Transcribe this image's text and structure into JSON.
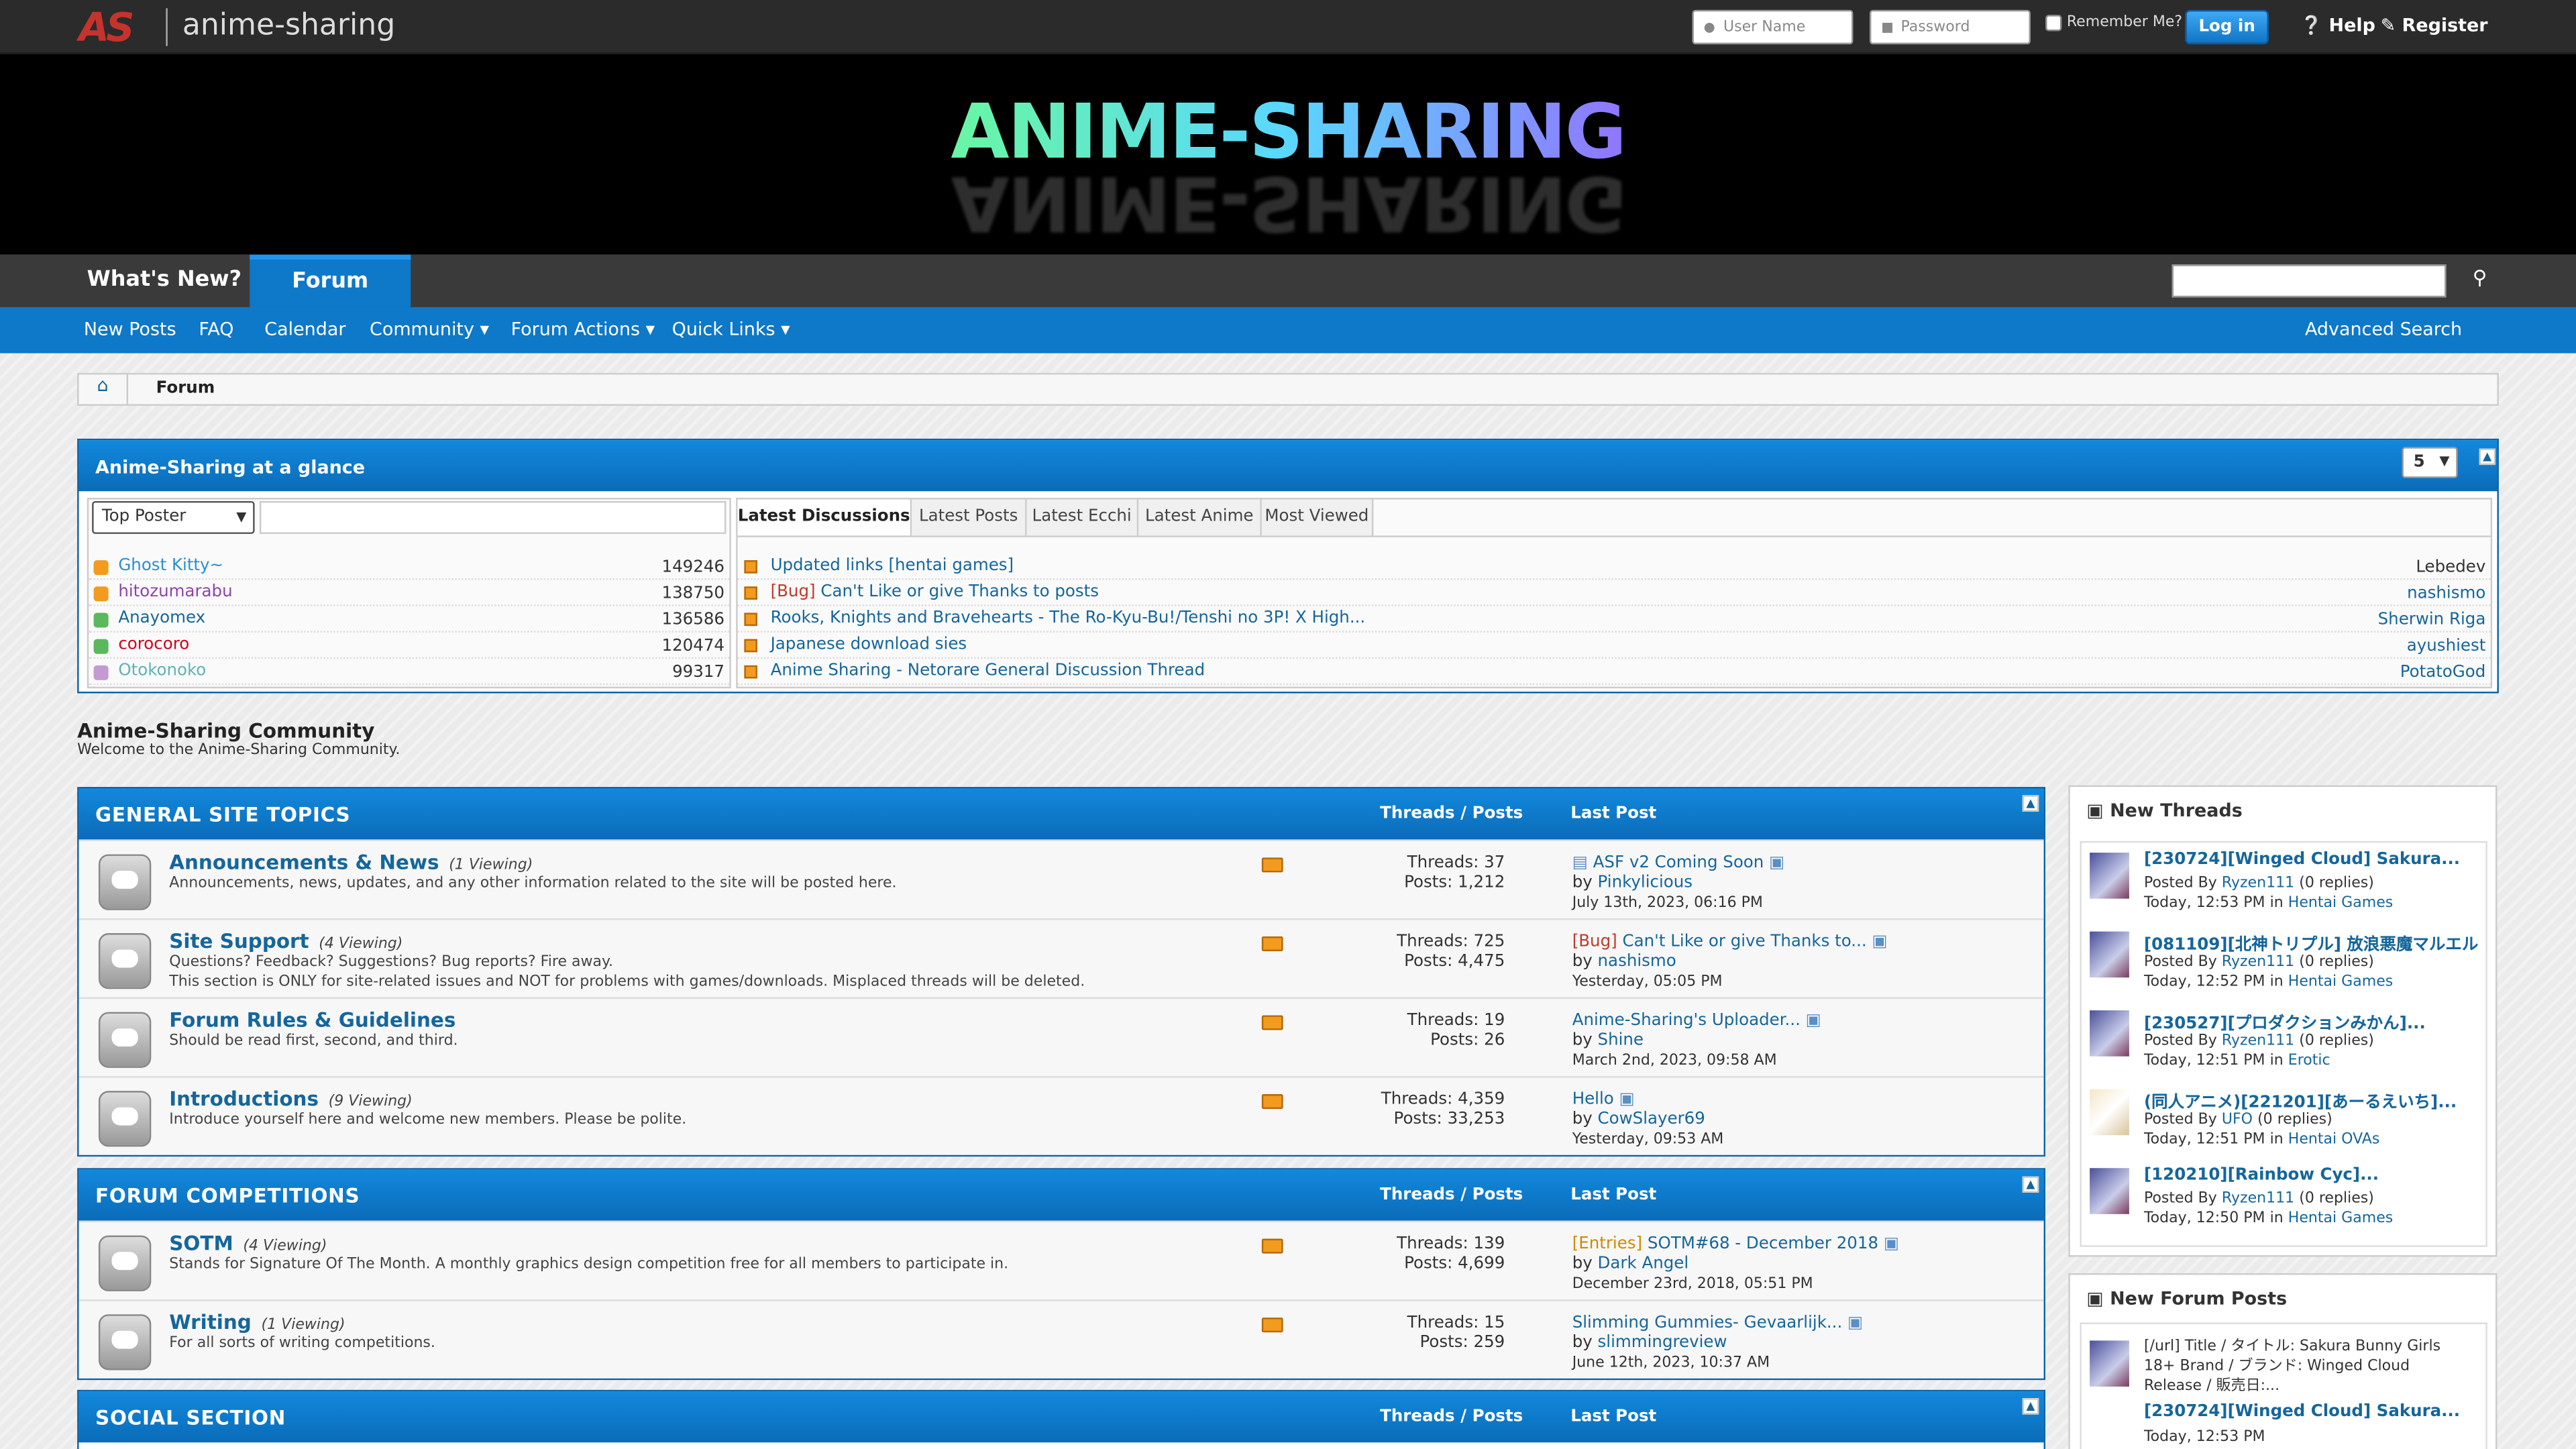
{
  "topbar": {
    "logo_mark": "AS",
    "site_name": "anime-sharing",
    "username_placeholder": "User Name",
    "password_placeholder": "Password",
    "remember_label": "Remember Me?",
    "login_label": "Log in",
    "help_label": "Help",
    "register_label": "Register"
  },
  "banner": {
    "title": "ANIME-SHARING"
  },
  "nav": {
    "tabs": [
      {
        "label": "What's New?"
      },
      {
        "label": "Forum"
      }
    ],
    "active_tab": "Forum",
    "search_placeholder": ""
  },
  "subnav": {
    "items": [
      {
        "label": "New Posts"
      },
      {
        "label": "FAQ"
      },
      {
        "label": "Calendar"
      },
      {
        "label": "Community",
        "dropdown": true
      },
      {
        "label": "Forum Actions",
        "dropdown": true
      },
      {
        "label": "Quick Links",
        "dropdown": true
      }
    ],
    "advanced_search": "Advanced Search"
  },
  "breadcrumb": {
    "current": "Forum"
  },
  "glance": {
    "title": "Anime-Sharing at a glance",
    "count_select": "5",
    "top_poster_select": "Top Poster",
    "top_posters": [
      {
        "name": "Ghost Kitty~",
        "count": "149246",
        "color": "#2a8ed6",
        "icon_color": "#f29b1e"
      },
      {
        "name": "hitozumarabu",
        "count": "138750",
        "color": "#8e44ad",
        "icon_color": "#f29b1e"
      },
      {
        "name": "Anayomex",
        "count": "136586",
        "color": "#15669c",
        "icon_color": "#5cb85c"
      },
      {
        "name": "corocoro",
        "count": "120474",
        "color": "#d0021b",
        "icon_color": "#5cb85c"
      },
      {
        "name": "Otokonoko",
        "count": "99317",
        "color": "#5fb3b3",
        "icon_color": "#c39bd3"
      }
    ],
    "tabs": [
      {
        "label": "Latest Discussions"
      },
      {
        "label": "Latest Posts"
      },
      {
        "label": "Latest Ecchi"
      },
      {
        "label": "Latest Anime"
      },
      {
        "label": "Most Viewed"
      }
    ],
    "active_tab": "Latest Discussions",
    "discussions": [
      {
        "prefix": "",
        "title": "Updated links [hentai games]",
        "user": "Lebedev",
        "user_color": "#333333"
      },
      {
        "prefix": "[Bug]",
        "title": "Can't Like or give Thanks to posts",
        "user": "nashismo",
        "user_color": "#15669c"
      },
      {
        "prefix": "",
        "title": "Rooks, Knights and Bravehearts - The Ro-Kyu-Bu!/Tenshi no 3P! X High...",
        "user": "Sherwin Riga",
        "user_color": "#15669c"
      },
      {
        "prefix": "",
        "title": "Japanese download sies",
        "user": "ayushiest",
        "user_color": "#15669c"
      },
      {
        "prefix": "",
        "title": "Anime Sharing - Netorare General Discussion Thread",
        "user": "PotatoGod",
        "user_color": "#15669c"
      }
    ]
  },
  "community": {
    "title": "Anime-Sharing Community",
    "subtitle": "Welcome to the Anime-Sharing Community."
  },
  "column_labels": {
    "threads_posts": "Threads / Posts",
    "last_post": "Last Post"
  },
  "sections": [
    {
      "title": "GENERAL SITE TOPICS",
      "forums": [
        {
          "name": "Announcements & News",
          "viewing": "(1 Viewing)",
          "desc": "Announcements, news, updates, and any other information related to the site will be posted here.",
          "threads": "Threads: 37",
          "posts": "Posts: 1,212",
          "last_prefix": "",
          "last_title": "ASF v2 Coming Soon",
          "last_by": "Pinkylicious",
          "last_date": "July 13th, 2023, 06:16 PM"
        },
        {
          "name": "Site Support",
          "viewing": "(4 Viewing)",
          "desc": "Questions? Feedback? Suggestions? Bug reports? Fire away.",
          "desc2": "This section is ONLY for site-related issues and NOT for problems with games/downloads. Misplaced threads will be deleted.",
          "threads": "Threads: 725",
          "posts": "Posts: 4,475",
          "last_prefix": "[Bug]",
          "last_title": "Can't Like or give Thanks to...",
          "last_by": "nashismo",
          "last_date": "Yesterday, 05:05 PM"
        },
        {
          "name": "Forum Rules & Guidelines",
          "viewing": "",
          "desc": "Should be read first, second, and third.",
          "threads": "Threads: 19",
          "posts": "Posts: 26",
          "last_prefix": "",
          "last_title": "Anime-Sharing's Uploader...",
          "last_by": "Shine",
          "last_date": "March 2nd, 2023, 09:58 AM"
        },
        {
          "name": "Introductions",
          "viewing": "(9 Viewing)",
          "desc": "Introduce yourself here and welcome new members. Please be polite.",
          "threads": "Threads: 4,359",
          "posts": "Posts: 33,253",
          "last_prefix": "",
          "last_title": "Hello",
          "last_by": "CowSlayer69",
          "last_date": "Yesterday, 09:53 AM"
        }
      ]
    },
    {
      "title": "FORUM COMPETITIONS",
      "forums": [
        {
          "name": "SOTM",
          "viewing": "(4 Viewing)",
          "desc": "Stands for Signature Of The Month. A monthly graphics design competition free for all members to participate in.",
          "threads": "Threads: 139",
          "posts": "Posts: 4,699",
          "last_prefix": "[Entries]",
          "last_title": "SOTM#68 - December 2018",
          "last_by": "Dark Angel",
          "last_date": "December 23rd, 2018, 05:51 PM"
        },
        {
          "name": "Writing",
          "viewing": "(1 Viewing)",
          "desc": "For all sorts of writing competitions.",
          "threads": "Threads: 15",
          "posts": "Posts: 259",
          "last_prefix": "",
          "last_title": "Slimming Gummies- Gevaarlijk...",
          "last_by": "slimmingreview",
          "last_date": "June 12th, 2023, 10:37 AM"
        }
      ]
    },
    {
      "title": "SOCIAL SECTION",
      "forums": []
    }
  ],
  "new_threads": {
    "title": "New Threads",
    "posted_by": "Posted By",
    "in_label": "in",
    "items": [
      {
        "title": "[230724][Winged Cloud] Sakura...",
        "user": "Ryzen111",
        "replies": "(0 replies)",
        "time": "Today, 12:53 PM",
        "forum": "Hentai Games"
      },
      {
        "title": "[081109][北神トリプル] 放浪悪魔マルエル",
        "user": "Ryzen111",
        "replies": "(0 replies)",
        "time": "Today, 12:52 PM",
        "forum": "Hentai Games"
      },
      {
        "title": "[230527][プロダクションみかん]...",
        "user": "Ryzen111",
        "replies": "(0 replies)",
        "time": "Today, 12:51 PM",
        "forum": "Erotic"
      },
      {
        "title": "(同人アニメ)[221201][あーるえいち]...",
        "user": "UFO",
        "replies": "(0 replies)",
        "time": "Today, 12:51 PM",
        "forum": "Hentai OVAs"
      },
      {
        "title": "[120210][Rainbow Cyc]...",
        "user": "Ryzen111",
        "replies": "(0 replies)",
        "time": "Today, 12:50 PM",
        "forum": "Hentai Games"
      }
    ]
  },
  "new_posts": {
    "title": "New Forum Posts",
    "items": [
      {
        "excerpt_1": "[/url] Title / タイトル: Sakura Bunny Girls",
        "excerpt_2": "18+ Brand / ブランド: Winged Cloud",
        "excerpt_3": "Release / 販売日:...",
        "title": "[230724][Winged Cloud] Sakura...",
        "time": "Today, 12:53 PM"
      }
    ]
  },
  "colors": {
    "accent": "#0e78c9",
    "link": "#15669c",
    "topbar": "#2b2b2b",
    "logo": "#c4342d"
  }
}
